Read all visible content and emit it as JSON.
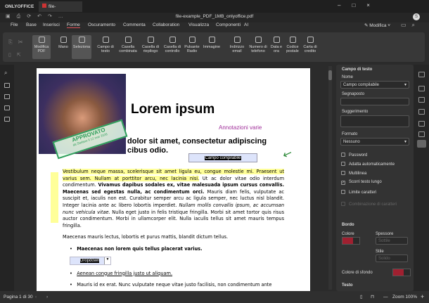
{
  "app": {
    "brand": "ONLYOFFICE",
    "tab": "file-example_...",
    "title": "file-example_PDF_1MB_onlyoffice.pdf",
    "avatar": "S"
  },
  "menu": [
    "File",
    "Base",
    "Inserisci",
    "Forme",
    "Oscuramento",
    "Commenta",
    "Collaboration",
    "Visualizza",
    "Componenti",
    "AI"
  ],
  "active_menu": "Forme",
  "mode": "Modifica",
  "ribbon": [
    {
      "label": "Modifica PDF",
      "selected": true
    },
    {
      "label": "Mano"
    },
    {
      "label": "Seleziona",
      "selected": true
    },
    {
      "label": "Campo di testo"
    },
    {
      "label": "Casella combinata"
    },
    {
      "label": "Casella di riepilogo"
    },
    {
      "label": "Casella di controllo"
    },
    {
      "label": "Pulsante Radio"
    },
    {
      "label": "Immagine"
    },
    {
      "label": "Indirizzo email"
    },
    {
      "label": "Numero di telefono"
    },
    {
      "label": "Data e ora"
    },
    {
      "label": "Codice postale"
    },
    {
      "label": "Carta di credito"
    }
  ],
  "doc": {
    "heading": "Lorem ipsum",
    "annotation": "Annotazioni varie",
    "subheading1": "dolor sit amet, consectetur adipiscing",
    "subheading2": "cibus odio.",
    "field": "Campo compilabile",
    "stamp": "APPROVATO",
    "stamp_sub": "da Stefano il 12 mar 2026",
    "p1_hl": "Vestibulum neque massa, scelerisque sit amet ligula eu, congue molestie mi. Praesent ut varius sem. Nullam at porttitor arcu, nec lacinia nisi.",
    "p1_a": " Ut ac dolor vitae odio interdum condimentum. ",
    "p1_b": "Vivamus dapibus sodales ex, vitae malesuada ipsum cursus convallis. Maecenas sed egestas nulla, ac condimentum orci.",
    "p1_c": " Mauris diam felis, vulputate ac suscipit et, iaculis non est. Curabitur semper arcu ac ligula semper, nec luctus nisl blandit. Integer lacinia ante ac libero lobortis imperdiet. ",
    "p1_d": "Nullam mollis convallis ipsum, ac accumsan nunc vehicula vitae.",
    "p1_e": " Nulla eget justo in felis tristique fringilla. Morbi sit amet tortor quis risus auctor condimentum. Morbi in ullamcorper elit. Nulla iaculis tellus sit amet mauris tempus fringilla.",
    "p2": "Maecenas mauris lectus, lobortis et purus mattis, blandit dictum tellus.",
    "li1": "Maecenas non lorem quis tellus placerat varius.",
    "dropdown": "Dropdown",
    "li2": "Aenean congue fringilla justo ut aliquam.",
    "li3": "Mauris id ex erat. Nunc vulputate neque vitae justo facilisis, non condimentum ante"
  },
  "panel": {
    "title": "Campo di testo",
    "name_label": "Nome",
    "name_value": "Campo compilabile",
    "placeholder_label": "Segnaposto",
    "tip_label": "Suggerimento",
    "format_label": "Formato",
    "format_value": "Nessuno",
    "checks": [
      {
        "label": "Password",
        "checked": false
      },
      {
        "label": "Adatta automaticamente",
        "checked": false
      },
      {
        "label": "Multilinea",
        "checked": false
      },
      {
        "label": "Scorri testo lungo",
        "checked": true
      },
      {
        "label": "Limite caratteri",
        "checked": false
      },
      {
        "label": "Combinazione di caratteri",
        "checked": false,
        "disabled": true
      }
    ],
    "border_title": "Bordo",
    "color_label": "Colore",
    "thickness_label": "Spessore",
    "thickness_value": "Sottile",
    "style_label": "Stile",
    "style_value": "Solido",
    "bg_label": "Colore di sfondo",
    "text_title": "Testo"
  },
  "status": {
    "page": "Pagina 1 di 30",
    "zoom": "Zoom 100%"
  },
  "colors": {
    "accent": "#e0525a",
    "highlight": "#ffff99",
    "annotation": "#a0309a",
    "stamp": "#2e9e5b"
  }
}
